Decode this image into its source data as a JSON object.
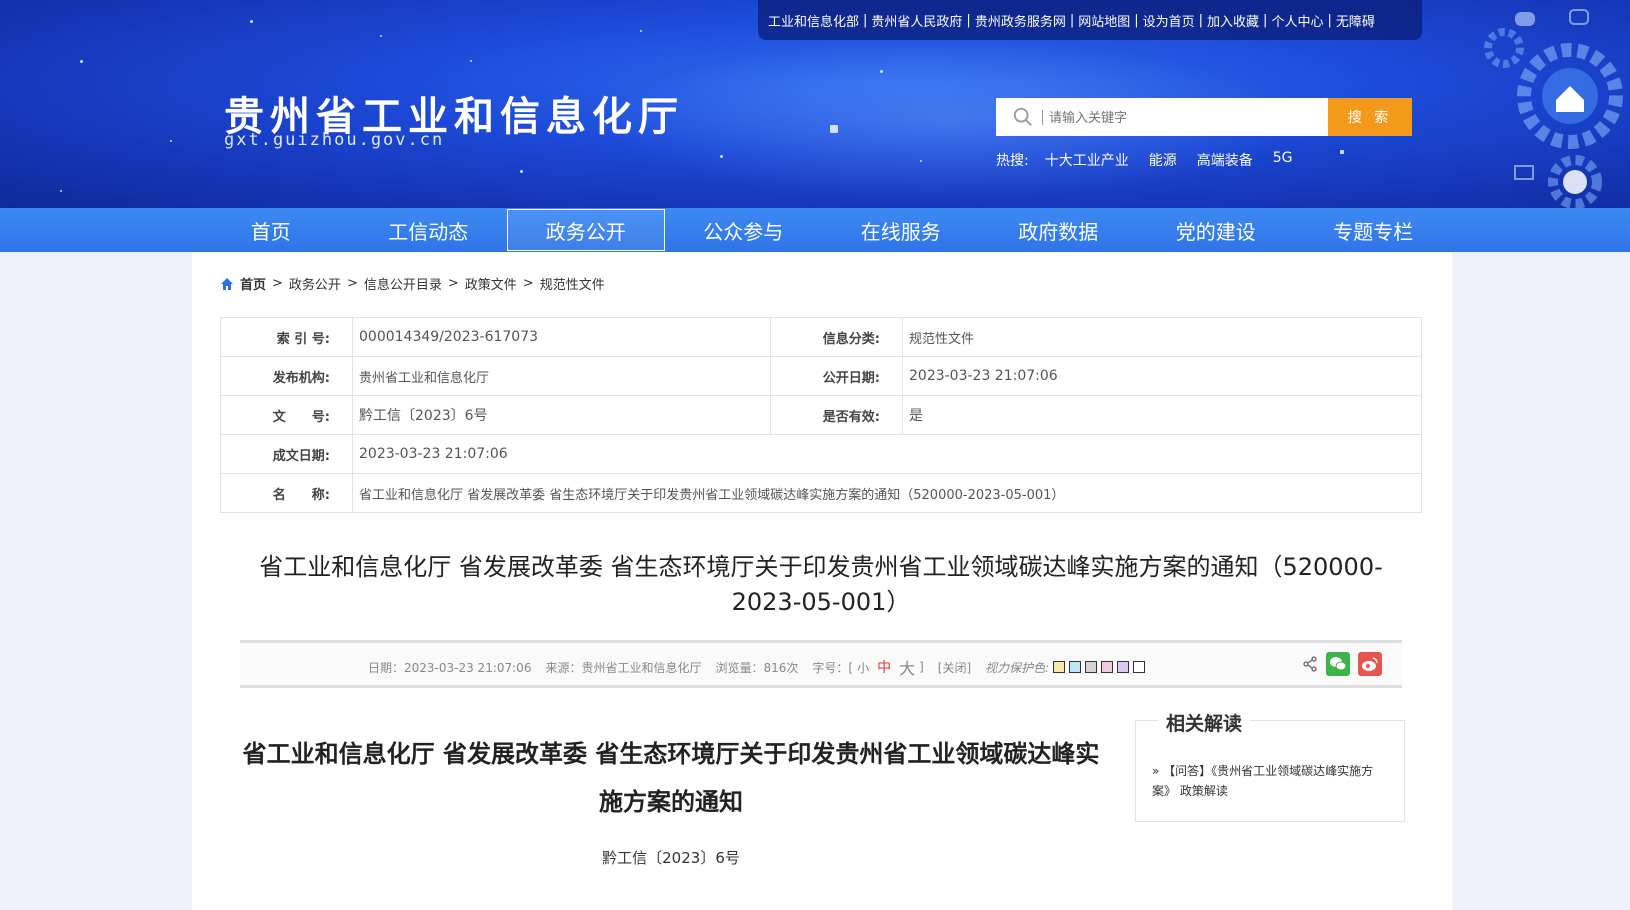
{
  "topbar": {
    "links": [
      "工业和信息化部",
      "贵州省人民政府",
      "贵州政务服务网",
      "网站地图",
      "设为首页",
      "加入收藏",
      "个人中心",
      "无障碍"
    ]
  },
  "site": {
    "title": "贵州省工业和信息化厅",
    "domain": "gxt.guizhou.gov.cn"
  },
  "search": {
    "placeholder": "请输入关键字",
    "button": "搜 索",
    "hot_label": "热搜:",
    "hot_terms": [
      "十大工业产业",
      "能源",
      "高端装备",
      "5G"
    ]
  },
  "nav": {
    "items": [
      "首页",
      "工信动态",
      "政务公开",
      "公众参与",
      "在线服务",
      "政府数据",
      "党的建设",
      "专题专栏"
    ],
    "active_index": 2
  },
  "breadcrumb": {
    "items": [
      "首页",
      "政务公开",
      "信息公开目录",
      "政策文件",
      "规范性文件"
    ],
    "separator": ">"
  },
  "info": {
    "index_no_label": "索 引 号:",
    "index_no": "000014349/2023-617073",
    "category_label": "信息分类:",
    "category": "规范性文件",
    "publisher_label": "发布机构:",
    "publisher": "贵州省工业和信息化厅",
    "public_date_label": "公开日期:",
    "public_date": "2023-03-23 21:07:06",
    "doc_no_label": "文　　号:",
    "doc_no": "黔工信〔2023〕6号",
    "valid_label": "是否有效:",
    "valid": "是",
    "created_label": "成文日期:",
    "created": "2023-03-23 21:07:06",
    "name_label": "名　　称:",
    "name": "省工业和信息化厅 省发展改革委 省生态环境厅关于印发贵州省工业领域碳达峰实施方案的通知（520000-2023-05-001）"
  },
  "doc": {
    "title": "省工业和信息化厅 省发展改革委 省生态环境厅关于印发贵州省工业领域碳达峰实施方案的通知（520000-2023-05-001）"
  },
  "meta": {
    "date": "日期：2023-03-23 21:07:06",
    "source": "来源：贵州省工业和信息化厅",
    "views": "浏览量：816次",
    "font_label": "字号：[",
    "font_small": "小",
    "font_mid": "中",
    "font_big": "大",
    "font_end": "]",
    "close": "[关闭]",
    "eye_label": "视力保护色:",
    "swatch_colors": [
      "#f5e9a8",
      "#bfe4f5",
      "#d4d4d4",
      "#f3c9dc",
      "#dcc9f0",
      "#ffffff"
    ]
  },
  "article": {
    "title": "省工业和信息化厅 省发展改革委 省生态环境厅关于印发贵州省工业领域碳达峰实施方案的通知",
    "doc_no": "黔工信〔2023〕6号"
  },
  "related": {
    "title": "相关解读",
    "items": [
      "» 【问答】《贵州省工业领域碳达峰实施方案》 政策解读"
    ]
  },
  "colors": {
    "header_blue": "#1d4ad8",
    "nav_blue": "#3d8af3",
    "search_orange": "#f39a1d",
    "wechat_green": "#3bb44a",
    "weibo_red": "#e6554e"
  }
}
